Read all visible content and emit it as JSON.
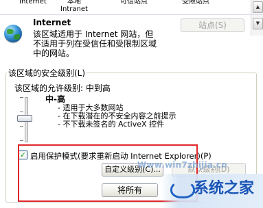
{
  "zones": [
    {
      "label": "Internet"
    },
    {
      "label": "本地 Intranet"
    },
    {
      "label": "可信站点"
    },
    {
      "label": "受限站点"
    }
  ],
  "zone_info": {
    "name": "Internet",
    "description_line1": "该区域适用于 Internet 网站，但",
    "description_line2": "不适用于列在受信任和受限制区域",
    "description_line3": "中的网站。",
    "sites_button": "站点(S)"
  },
  "security": {
    "group_title": "该区域的安全级别(L)",
    "allowed_levels": "该区域的允许级别: 中到高",
    "level_name": "中-高",
    "bullets": [
      "- 适用于大多数网站",
      "- 在下载潜在的不安全内容之前提示",
      "- 不下载未签名的 ActiveX 控件"
    ],
    "protected_mode_checked": true,
    "protected_mode_label": "启用保护模式(要求重新启动 Internet Explorer)(P)",
    "custom_level_button": "自定义级别(C)...",
    "default_level_button": "默认级别(D)",
    "reset_all_button": "将所有"
  },
  "watermark": {
    "url": "Www.win7zhijia.cn",
    "logo_text": "系统之家"
  }
}
